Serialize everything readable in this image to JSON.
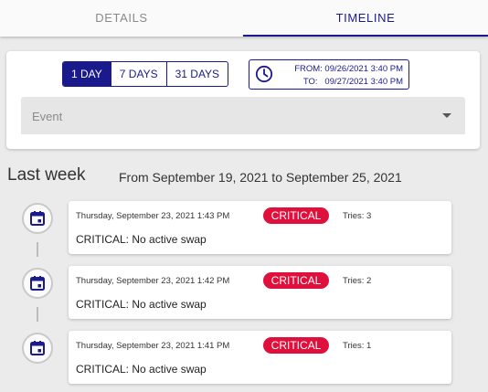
{
  "tabs": [
    {
      "label": "DETAILS",
      "active": false
    },
    {
      "label": "TIMELINE",
      "active": true
    }
  ],
  "filters": {
    "ranges": [
      {
        "label": "1 DAY",
        "active": true
      },
      {
        "label": "7 DAYS",
        "active": false
      },
      {
        "label": "31 DAYS",
        "active": false
      }
    ],
    "date_range": {
      "from_text": "FROM: 09/26/2021 3:40 PM",
      "to_text": "TO:   09/27/2021 3:40 PM",
      "icon": "clock-icon"
    },
    "event_select": {
      "placeholder": "Event",
      "icon": "caret-down-icon"
    }
  },
  "timeline": {
    "heading": "Last week",
    "range_text": "From September 19, 2021 to September 25, 2021",
    "entries": [
      {
        "timestamp": "Thursday, September 23, 2021 1:43 PM",
        "severity": "CRITICAL",
        "tries": "Tries: 3",
        "message": "CRITICAL: No active swap"
      },
      {
        "timestamp": "Thursday, September 23, 2021 1:42 PM",
        "severity": "CRITICAL",
        "tries": "Tries: 2",
        "message": "CRITICAL: No active swap"
      },
      {
        "timestamp": "Thursday, September 23, 2021 1:41 PM",
        "severity": "CRITICAL",
        "tries": "Tries: 1",
        "message": "CRITICAL: No active swap"
      }
    ]
  },
  "colors": {
    "accent": "#1a1a8c",
    "critical": "#e0103c",
    "background": "#ebebeb"
  }
}
